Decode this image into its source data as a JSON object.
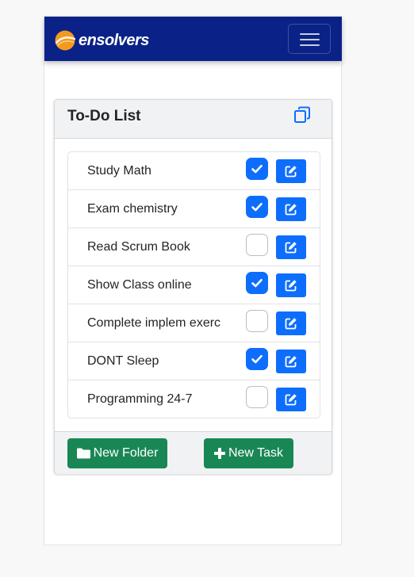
{
  "navbar": {
    "brand_text": "ensolvers",
    "brand_icon": "ensolvers-logo-icon",
    "menu_icon": "hamburger-icon"
  },
  "card": {
    "title": "To-Do List",
    "copy_icon": "copy-icon"
  },
  "tasks": [
    {
      "label": "Study Math",
      "done": true
    },
    {
      "label": "Exam chemistry",
      "done": true
    },
    {
      "label": "Read Scrum Book",
      "done": false
    },
    {
      "label": "Show Class online",
      "done": true
    },
    {
      "label": "Complete implem exerc",
      "done": false
    },
    {
      "label": "DONT Sleep",
      "done": true
    },
    {
      "label": "Programming 24-7",
      "done": false
    }
  ],
  "footer": {
    "new_folder_label": "New Folder",
    "new_folder_icon": "folder-icon",
    "new_task_label": "New Task",
    "new_task_icon": "plus-icon"
  },
  "colors": {
    "navbar": "#0a2287",
    "primary": "#0d6efd",
    "success": "#198754",
    "logo_orange": "#f39a1e"
  }
}
